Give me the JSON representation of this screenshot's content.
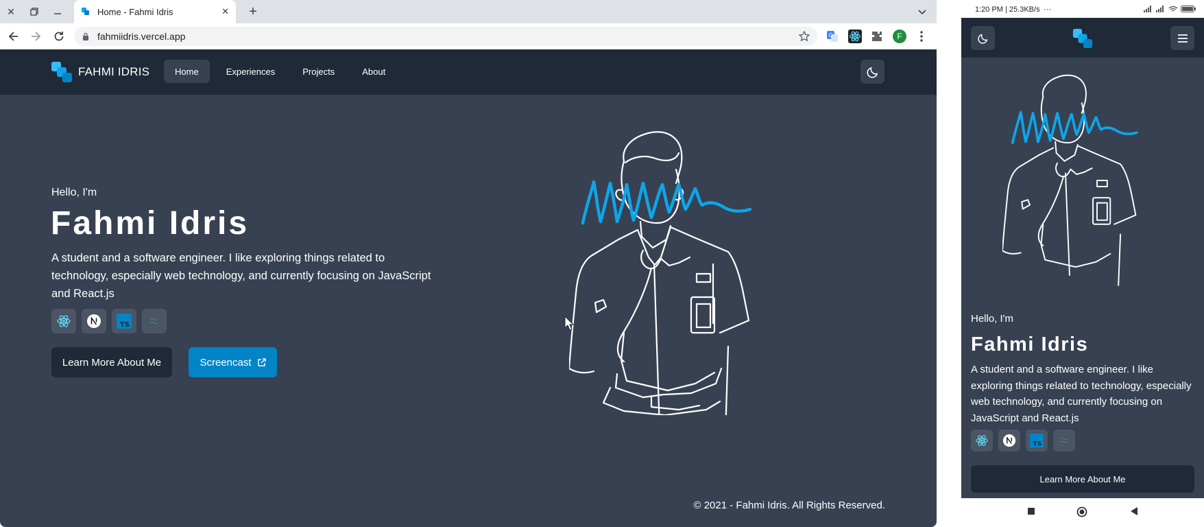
{
  "browser": {
    "tab_title": "Home - Fahmi Idris",
    "url": "fahmiidris.vercel.app",
    "profile_initial": "F"
  },
  "site": {
    "brand": "FAHMI IDRIS",
    "nav": [
      "Home",
      "Experiences",
      "Projects",
      "About"
    ],
    "hero": {
      "greeting": "Hello, I'm",
      "name": "Fahmi Idris",
      "description": "A student and a software engineer. I like exploring things related to technology, especially web technology, and currently focusing on JavaScript and React.js"
    },
    "tech_icons": [
      "react-icon",
      "nextjs-icon",
      "typescript-icon",
      "tailwind-icon"
    ],
    "buttons": {
      "learn_more": "Learn More About Me",
      "screencast": "Screencast"
    },
    "footer": "© 2021 - Fahmi Idris. All Rights Reserved.",
    "colors": {
      "page_bg": "#374151",
      "nav_bg": "#1f2937",
      "accent": "#0284c7",
      "scribble": "#0ea5e9"
    }
  },
  "phone": {
    "status_time": "1:20 PM | 25.3KB/s",
    "greeting": "Hello, I'm",
    "name": "Fahmi Idris",
    "description": "A student and a software engineer. I like exploring things related to technology, especially web technology, and currently focusing on JavaScript and React.js",
    "button": "Learn More About Me"
  }
}
